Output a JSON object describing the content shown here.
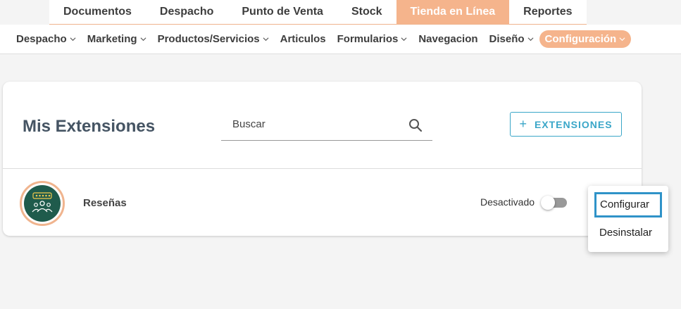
{
  "top_tabs": [
    {
      "label": "Documentos"
    },
    {
      "label": "Despacho"
    },
    {
      "label": "Punto de Venta"
    },
    {
      "label": "Stock"
    },
    {
      "label": "Tienda en Línea"
    },
    {
      "label": "Reportes"
    }
  ],
  "sub_nav": [
    {
      "label": "Despacho"
    },
    {
      "label": "Marketing"
    },
    {
      "label": "Productos/Servicios"
    },
    {
      "label": "Articulos"
    },
    {
      "label": "Formularios"
    },
    {
      "label": "Navegacion"
    },
    {
      "label": "Diseño"
    },
    {
      "label": "Configuración"
    }
  ],
  "card": {
    "title": "Mis Extensiones",
    "search_placeholder": "Buscar",
    "add_label": "EXTENSIONES"
  },
  "extension": {
    "name": "Reseñas",
    "status_label": "Desactivado",
    "enabled": false
  },
  "menu": {
    "items": [
      {
        "label": "Configurar"
      },
      {
        "label": "Desinstalar"
      }
    ]
  },
  "colors": {
    "accent": "#f5b48c",
    "primary": "#3aa6c8",
    "focus": "#2f93c8"
  }
}
